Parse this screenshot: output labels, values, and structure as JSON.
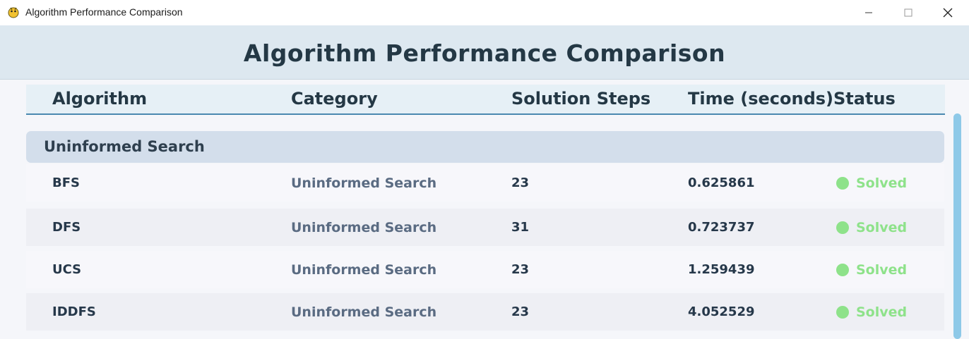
{
  "window": {
    "title": "Algorithm Performance Comparison",
    "icon": "pygame-snake-icon",
    "controls": [
      "minimize-icon",
      "maximize-icon",
      "close-icon"
    ]
  },
  "header": {
    "title": "Algorithm Performance Comparison"
  },
  "table": {
    "columns": [
      "Algorithm",
      "Category",
      "Solution Steps",
      "Time (seconds)",
      "Status"
    ],
    "group": "Uninformed Search",
    "rows": [
      {
        "algorithm": "BFS",
        "category": "Uninformed Search",
        "steps": "23",
        "time": "0.625861",
        "status": "Solved"
      },
      {
        "algorithm": "DFS",
        "category": "Uninformed Search",
        "steps": "31",
        "time": "0.723737",
        "status": "Solved"
      },
      {
        "algorithm": "UCS",
        "category": "Uninformed Search",
        "steps": "23",
        "time": "1.259439",
        "status": "Solved"
      },
      {
        "algorithm": "IDDFS",
        "category": "Uninformed Search",
        "steps": "23",
        "time": "4.052529",
        "status": "Solved"
      }
    ]
  },
  "colors": {
    "header_bg": "#dde8f0",
    "accent": "#4a89b0",
    "solved": "#8ee28a",
    "scrollbar": "#8ec9e8"
  }
}
